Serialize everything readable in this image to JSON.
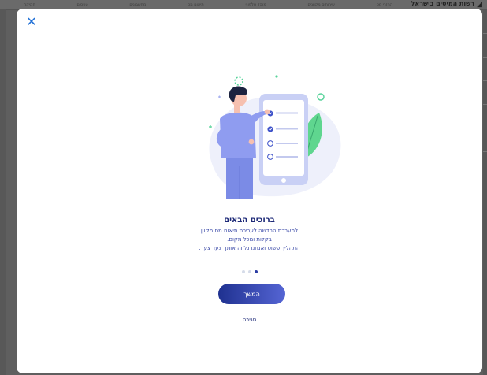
{
  "background": {
    "site_title": "רשות המיסים בישראל",
    "nav_items": [
      "החזרי מס",
      "שירותים מקוונים",
      "מוקד טלפוני",
      "תיאום מס",
      "מחשבונים",
      "טפסים",
      "חקיקה"
    ]
  },
  "modal": {
    "close_icon": "✕",
    "heading": "ברוכים הבאים",
    "description_lines": [
      "למערכת החדשה לעריכת תיאום מס מקוון",
      "בקלות ומכל מקום.",
      "התהליך פשוט ואנחנו נלווה אותך צעד צעד."
    ],
    "pagination": {
      "total": 3,
      "active_index": 3
    },
    "continue_label": "המשך",
    "close_label": "סגירה"
  },
  "colors": {
    "accent": "#1f6fd6",
    "heading": "#1e2a78",
    "button_start": "#1f3190",
    "button_end": "#5565d4"
  }
}
